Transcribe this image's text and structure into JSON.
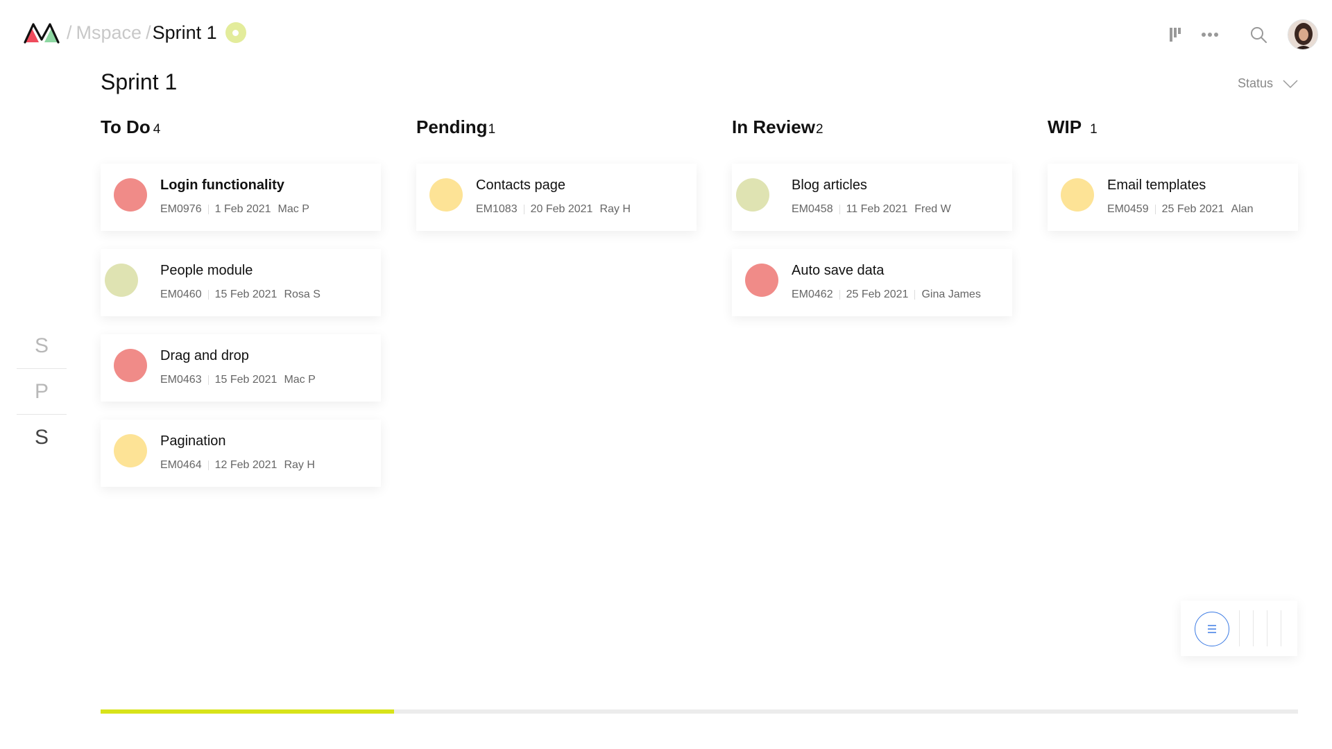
{
  "breadcrumb": {
    "sep": "/",
    "workspace": "Mspace",
    "sep2": "/",
    "current": "Sprint 1"
  },
  "title": "Sprint 1",
  "status_filter": {
    "label": "Status"
  },
  "rail": [
    "S",
    "P",
    "S"
  ],
  "columns": [
    {
      "title": "To Do",
      "count": "4",
      "cards": [
        {
          "title": "Login functionality",
          "id": "EM0976",
          "date": "1 Feb 2021",
          "assignee": "Mac P",
          "color": "#f08b88",
          "bold": true
        },
        {
          "title": "People module",
          "id": "EM0460",
          "date": "15 Feb 2021",
          "assignee": "Rosa S",
          "color": "#dfe3b2",
          "bold": false
        },
        {
          "title": "Drag and drop",
          "id": "EM0463",
          "date": "15 Feb 2021",
          "assignee": "Mac P",
          "color": "#f08b88",
          "bold": false
        },
        {
          "title": "Pagination",
          "id": "EM0464",
          "date": "12 Feb 2021",
          "assignee": "Ray H",
          "color": "#fde396",
          "bold": false
        }
      ]
    },
    {
      "title": "Pending",
      "count": "1",
      "cards": [
        {
          "title": "Contacts page",
          "id": "EM1083",
          "date": "20 Feb 2021",
          "assignee": "Ray H",
          "color": "#fde396",
          "bold": false
        }
      ]
    },
    {
      "title": "In Review",
      "count": "2",
      "cards": [
        {
          "title": "Blog articles",
          "id": "EM0458",
          "date": "11 Feb 2021",
          "assignee": "Fred W",
          "color": "#dfe3b2",
          "bold": false
        },
        {
          "title": "Auto save data",
          "id": "EM0462",
          "date": "25 Feb 2021",
          "assignee": "Gina James",
          "color": "#f08b88",
          "bold": false
        }
      ]
    },
    {
      "title": "WIP",
      "count": "1",
      "cards": [
        {
          "title": "Email templates",
          "id": "EM0459",
          "date": "25 Feb 2021",
          "assignee": "Alan",
          "color": "#fde396",
          "bold": false
        }
      ]
    }
  ],
  "progress": {
    "fraction": 0.245,
    "color": "#d8e31a"
  },
  "colors": {
    "accent": "#3c7be4",
    "status_dot": "#e3ec9b"
  },
  "icons": [
    "logo-icon",
    "board-view-icon",
    "more-icon",
    "search-icon",
    "avatar",
    "list-view-icon"
  ]
}
